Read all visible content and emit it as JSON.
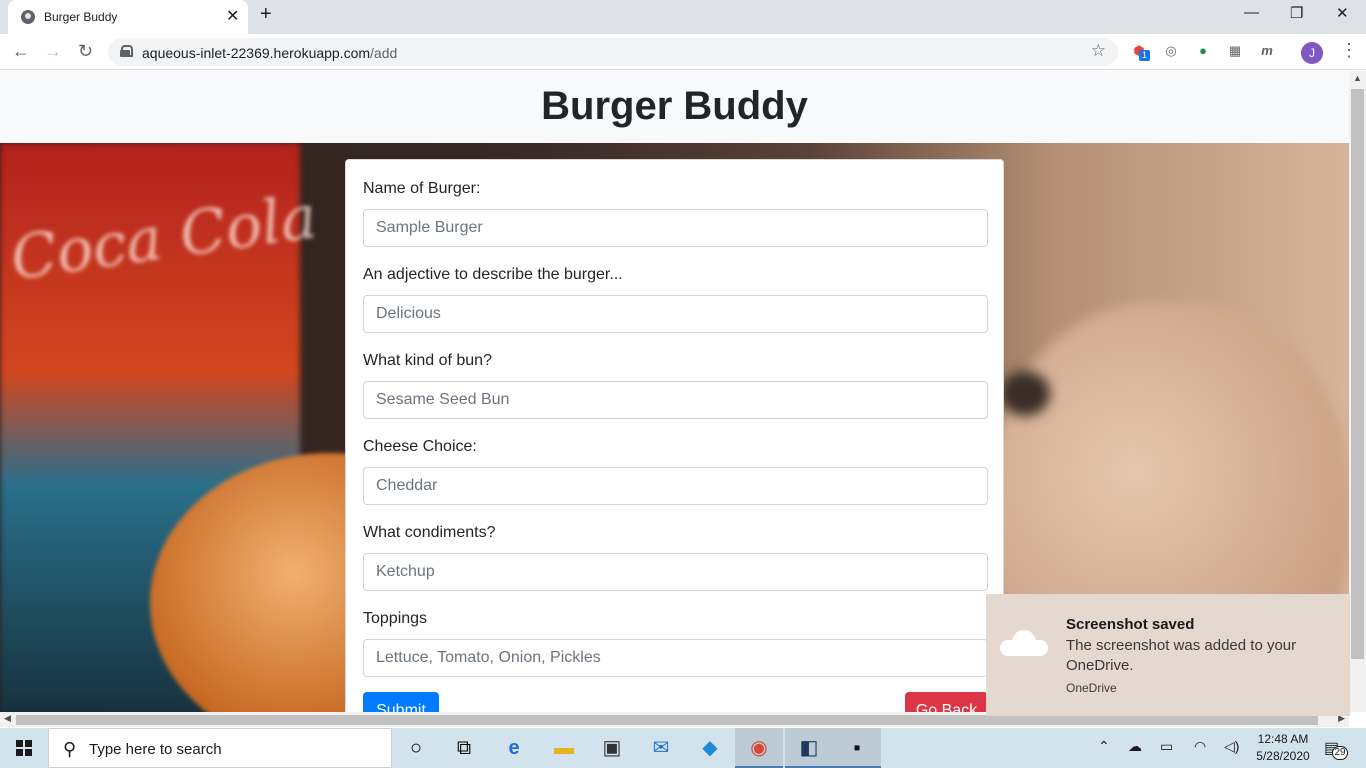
{
  "browser": {
    "tab_title": "Burger Buddy",
    "url_host": "aqueous-inlet-22369.herokuapp.com",
    "url_path": "/add",
    "avatar_initial": "J",
    "ext_badge": "1"
  },
  "page": {
    "brand": "Burger Buddy",
    "form": {
      "fields": [
        {
          "label": "Name of Burger:",
          "placeholder": "Sample Burger"
        },
        {
          "label": "An adjective to describe the burger...",
          "placeholder": "Delicious"
        },
        {
          "label": "What kind of bun?",
          "placeholder": "Sesame Seed Bun"
        },
        {
          "label": "Cheese Choice:",
          "placeholder": "Cheddar"
        },
        {
          "label": "What condiments?",
          "placeholder": "Ketchup"
        },
        {
          "label": "Toppings",
          "placeholder": "Lettuce, Tomato, Onion, Pickles"
        }
      ],
      "submit_label": "Submit",
      "goback_label": "Go Back"
    }
  },
  "toast": {
    "title": "Screenshot saved",
    "message": "The screenshot was added to your OneDrive.",
    "source": "OneDrive"
  },
  "taskbar": {
    "search_placeholder": "Type here to search",
    "time": "12:48 AM",
    "date": "5/28/2020",
    "notification_count": "29"
  },
  "colors": {
    "primary": "#007bff",
    "danger": "#dc3545",
    "header_bg": "#f8f9fa"
  }
}
